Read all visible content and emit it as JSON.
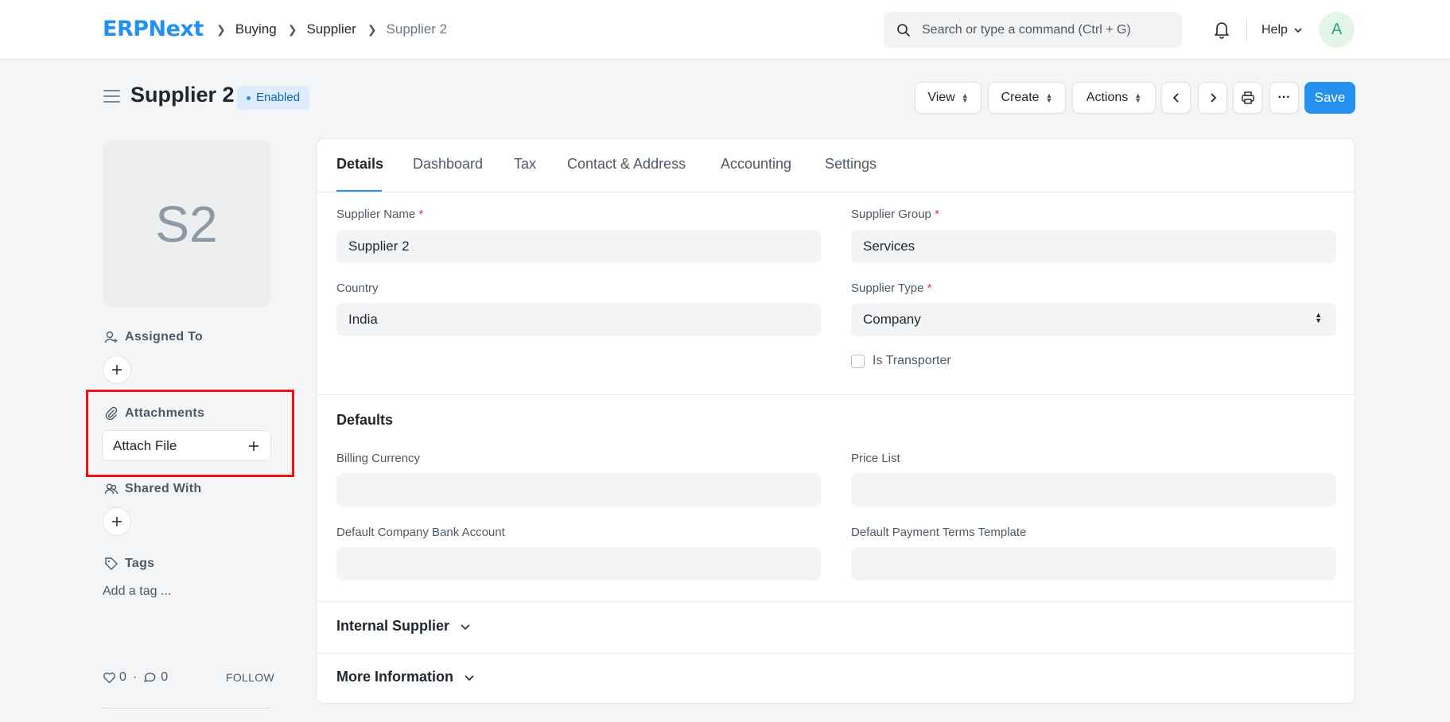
{
  "app": {
    "logo": "ERPNext"
  },
  "breadcrumbs": [
    "Buying",
    "Supplier",
    "Supplier 2"
  ],
  "search": {
    "placeholder": "Search or type a command (Ctrl + G)"
  },
  "navbar": {
    "help_label": "Help",
    "avatar_initial": "A"
  },
  "page": {
    "title": "Supplier 2",
    "status": "Enabled"
  },
  "toolbar": {
    "view": "View",
    "create": "Create",
    "actions": "Actions",
    "more": "···",
    "save": "Save"
  },
  "sidebar": {
    "image_initials": "S2",
    "assigned_to": "Assigned To",
    "attachments": "Attachments",
    "attach_file": "Attach File",
    "shared_with": "Shared With",
    "tags": "Tags",
    "add_tag": "Add a tag ...",
    "likes": "0",
    "comments": "0",
    "dot": "·",
    "follow": "FOLLOW"
  },
  "tabs": [
    "Details",
    "Dashboard",
    "Tax",
    "Contact & Address",
    "Accounting",
    "Settings"
  ],
  "form": {
    "supplier_name": {
      "label": "Supplier Name",
      "value": "Supplier 2"
    },
    "supplier_group": {
      "label": "Supplier Group",
      "value": "Services"
    },
    "country": {
      "label": "Country",
      "value": "India"
    },
    "supplier_type": {
      "label": "Supplier Type",
      "value": "Company"
    },
    "is_transporter": {
      "label": "Is Transporter"
    }
  },
  "defaults": {
    "title": "Defaults",
    "billing_currency": {
      "label": "Billing Currency",
      "value": ""
    },
    "price_list": {
      "label": "Price List",
      "value": ""
    },
    "default_company_bank_account": {
      "label": "Default Company Bank Account",
      "value": ""
    },
    "default_payment_terms_template": {
      "label": "Default Payment Terms Template",
      "value": ""
    }
  },
  "sections": {
    "internal_supplier": "Internal Supplier",
    "more_information": "More Information"
  },
  "colors": {
    "accent": "#2490ef",
    "highlight": "#ee1111",
    "required": "#e03636"
  }
}
